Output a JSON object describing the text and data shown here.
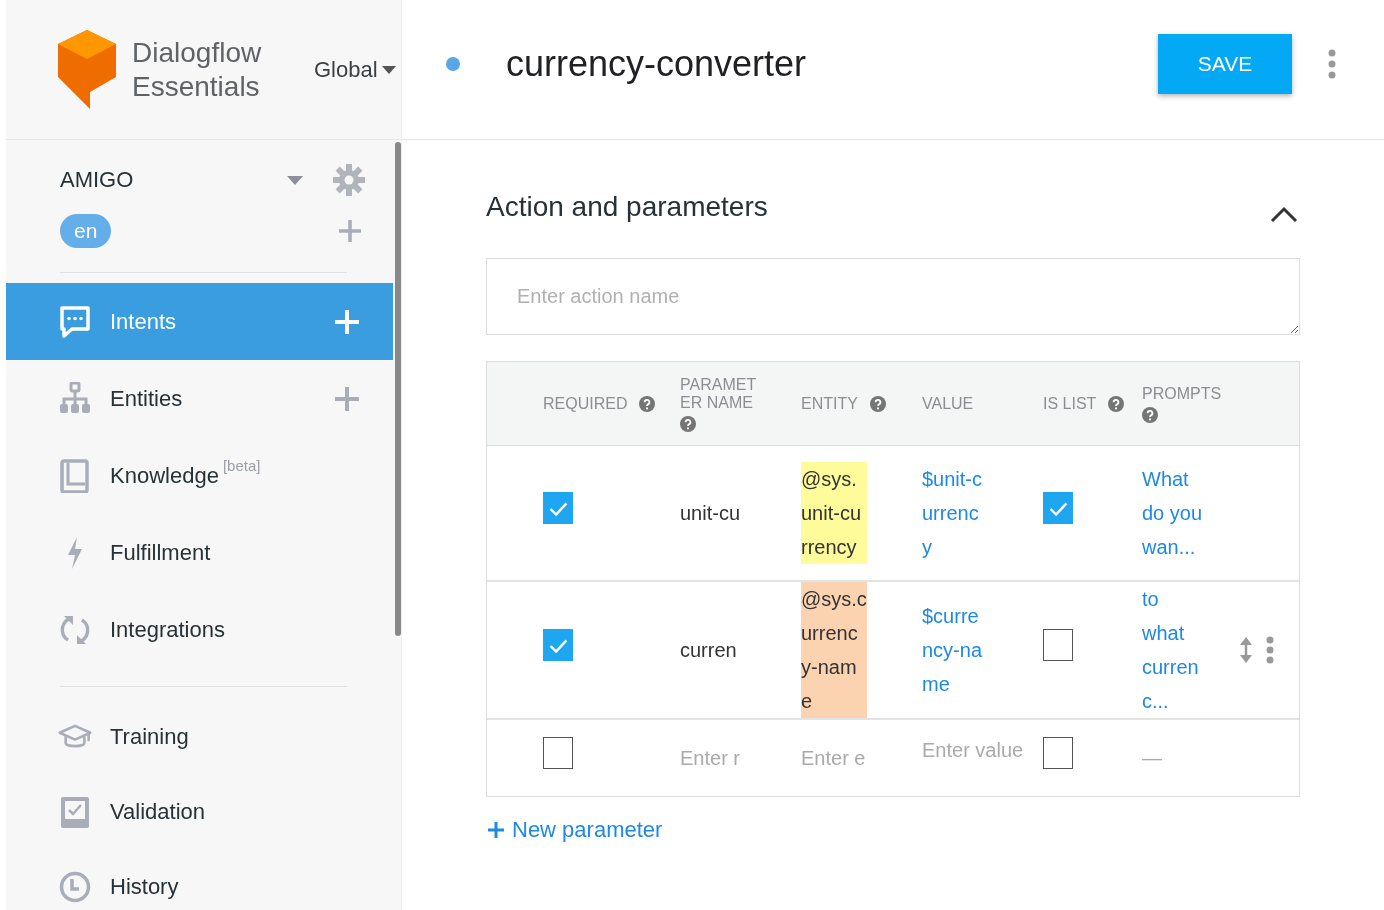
{
  "brand": {
    "name": "Dialogflow Essentials",
    "region": "Global"
  },
  "agent": {
    "name": "AMIGO",
    "language": "en"
  },
  "sidebar": {
    "groups": [
      [
        {
          "label": "Intents",
          "selected": true,
          "add": true
        },
        {
          "label": "Entities",
          "selected": false,
          "add": true
        },
        {
          "label": "Knowledge",
          "badge": "[beta]",
          "selected": false,
          "add": false
        },
        {
          "label": "Fulfillment",
          "selected": false,
          "add": false
        },
        {
          "label": "Integrations",
          "selected": false,
          "add": false
        }
      ],
      [
        {
          "label": "Training",
          "selected": false,
          "add": false
        },
        {
          "label": "Validation",
          "selected": false,
          "add": false
        },
        {
          "label": "History",
          "selected": false,
          "add": false
        }
      ]
    ]
  },
  "intent": {
    "title": "currency-converter",
    "save": "SAVE"
  },
  "section": {
    "title": "Action and parameters",
    "expanded": true,
    "action_placeholder": "Enter action name"
  },
  "table": {
    "columns": [
      {
        "label": "REQUIRED",
        "help": true
      },
      {
        "label": "PARAMETER NAME",
        "help": true
      },
      {
        "label": "ENTITY",
        "help": true
      },
      {
        "label": "VALUE",
        "help": false
      },
      {
        "label": "IS LIST",
        "help": true
      },
      {
        "label": "PROMPTS",
        "help": true
      }
    ],
    "rows": [
      {
        "kind": "param",
        "required": true,
        "name": "unit-cu",
        "entity": "@sys.unit-currency",
        "color": "#fdfb9a",
        "value": "$unit-currency",
        "is_list": true,
        "prompts": "What do you wan...",
        "hovered": false
      },
      {
        "kind": "param",
        "required": true,
        "name": "curren",
        "entity": "@sys.currency-name",
        "color": "#fcd3b0",
        "value": "$currency-name",
        "is_list": false,
        "prompts": "to what currenc...",
        "hovered": true
      },
      {
        "kind": "new",
        "required": false,
        "name_placeholder": "Enter r",
        "entity_placeholder": "Enter e",
        "value_placeholder": "Enter value",
        "is_list": false,
        "prompts": "—",
        "hovered": false
      }
    ]
  },
  "new_parameter": "New parameter"
}
